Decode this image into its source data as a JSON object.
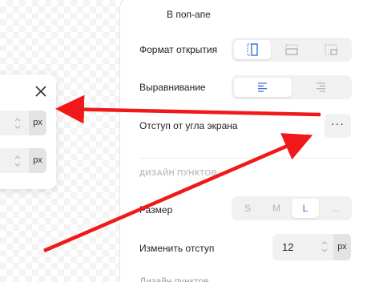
{
  "popup": {
    "fields": [
      {
        "unit": "px"
      },
      {
        "unit": "px"
      }
    ]
  },
  "panel": {
    "in_popup_label": "В поп-апе",
    "open_format": {
      "label": "Формат открытия",
      "options": [
        "side-panel-icon",
        "top-panel-icon",
        "corner-panel-icon"
      ],
      "selected": 0
    },
    "alignment": {
      "label": "Выравнивание",
      "options": [
        "align-left-icon",
        "align-right-icon"
      ],
      "selected": 0
    },
    "corner_offset": {
      "label": "Отступ от угла экрана",
      "button": "···"
    },
    "section_title": "ДИЗАЙН ПУНКТОВ",
    "size": {
      "label": "Размер",
      "options": [
        "S",
        "M",
        "L",
        "..."
      ],
      "selected": "L"
    },
    "change_offset": {
      "label": "Изменить отступ",
      "value": "12",
      "unit": "px"
    },
    "next_label_partial": "Дизайн пунктов"
  },
  "colors": {
    "accent": "#3b6fd8",
    "arrow": "#f01818",
    "field_bg": "#f1f1f2"
  }
}
